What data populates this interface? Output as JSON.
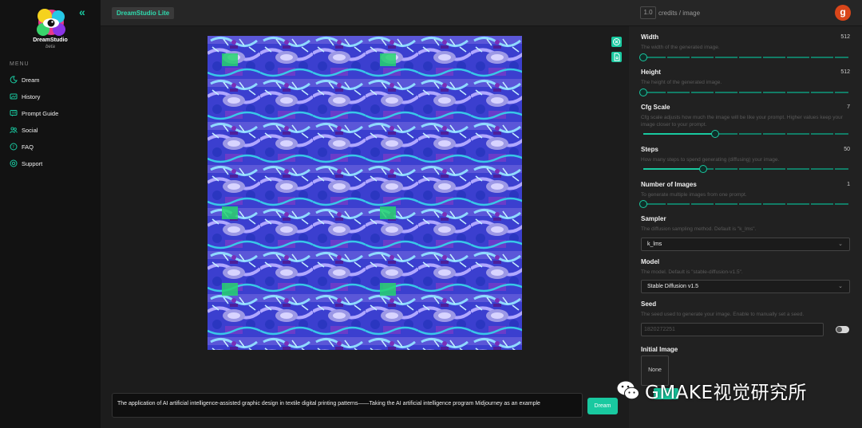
{
  "app": {
    "brand": "DreamStudio",
    "brand_tag": "beta",
    "product_tab": "DreamStudio Lite"
  },
  "header": {
    "credits_value": "1.0",
    "credits_label": "credits / image",
    "user_initial": "g"
  },
  "sidebar": {
    "menu_heading": "MENU",
    "items": [
      {
        "label": "Dream",
        "icon": "dream-icon"
      },
      {
        "label": "History",
        "icon": "history-icon"
      },
      {
        "label": "Prompt Guide",
        "icon": "prompt-guide-icon"
      },
      {
        "label": "Social",
        "icon": "social-icon"
      },
      {
        "label": "FAQ",
        "icon": "faq-icon"
      },
      {
        "label": "Support",
        "icon": "support-icon"
      }
    ]
  },
  "canvas": {
    "icon_tools": [
      "clear-icon",
      "download-icon"
    ]
  },
  "prompt": {
    "text": "The application of AI artificial intelligence-assisted graphic design in textile digital printing patterns——Taking the AI artificial intelligence program Midjourney as an example",
    "button": "Dream"
  },
  "settings": {
    "width": {
      "title": "Width",
      "value": "512",
      "desc": "The width of the generated image.",
      "fraction": 0.0
    },
    "height": {
      "title": "Height",
      "value": "512",
      "desc": "The height of the generated image.",
      "fraction": 0.0
    },
    "cfg_scale": {
      "title": "Cfg Scale",
      "value": "7",
      "desc": "Cfg scale adjusts how much the image will be like your prompt. Higher values keep your image closer to your prompt.",
      "fraction": 0.35
    },
    "steps": {
      "title": "Steps",
      "value": "50",
      "desc": "How many steps to spend generating (diffusing) your image.",
      "fraction": 0.29
    },
    "num_images": {
      "title": "Number of Images",
      "value": "1",
      "desc": "To generate multiple images from one prompt.",
      "fraction": 0.0
    },
    "sampler": {
      "title": "Sampler",
      "desc": "The diffusion sampling method. Default is \"k_lms\".",
      "selected": "k_lms"
    },
    "model": {
      "title": "Model",
      "desc": "The model. Default is \"stable-diffusion-v1.5\".",
      "selected": "Stable Diffusion v1.5"
    },
    "seed": {
      "title": "Seed",
      "desc": "The seed used to generate your image. Enable to manually set a seed.",
      "value": "1820272251"
    },
    "initial_image": {
      "title": "Initial Image",
      "value": "None"
    }
  },
  "watermark": {
    "text": "GMAKE视觉研究所"
  },
  "colors": {
    "accent": "#19c9a0",
    "avatar": "#d9461a",
    "background": "#1c1c1c"
  }
}
